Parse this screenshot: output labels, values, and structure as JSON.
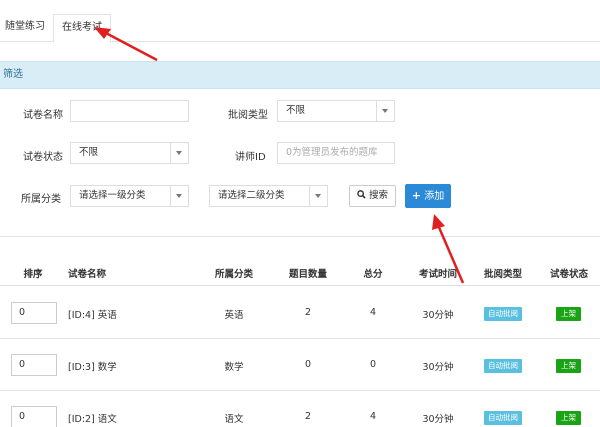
{
  "tabs": [
    {
      "label": "随堂练习",
      "active": false
    },
    {
      "label": "在线考试",
      "active": true
    }
  ],
  "filter": {
    "header": "筛选",
    "paper_name": {
      "label": "试卷名称",
      "value": ""
    },
    "review_type": {
      "label": "批阅类型",
      "value": "不限"
    },
    "paper_status": {
      "label": "试卷状态",
      "value": "不限"
    },
    "teacher_id": {
      "label": "讲师ID",
      "placeholder": "0为管理员发布的题库"
    },
    "category": {
      "label": "所属分类",
      "level1": "请选择一级分类",
      "level2": "请选择二级分类"
    },
    "search_button": "搜索",
    "add_button": "添加"
  },
  "table": {
    "headers": [
      "排序",
      "试卷名称",
      "所属分类",
      "题目数量",
      "总分",
      "考试时间",
      "批阅类型",
      "试卷状态"
    ],
    "rows": [
      {
        "sort": "0",
        "name": "[ID:4] 英语",
        "category": "英语",
        "count": "2",
        "score": "4",
        "time": "30分钟",
        "review": "自动批阅",
        "status": "上架"
      },
      {
        "sort": "0",
        "name": "[ID:3] 数学",
        "category": "数学",
        "count": "0",
        "score": "0",
        "time": "30分钟",
        "review": "自动批阅",
        "status": "上架"
      },
      {
        "sort": "0",
        "name": "[ID:2] 语文",
        "category": "语文",
        "count": "2",
        "score": "4",
        "time": "30分钟",
        "review": "自动批阅",
        "status": "上架"
      }
    ]
  },
  "colors": {
    "primary": "#2b8ad8",
    "filter_bg": "#d9edf7",
    "badge_blue": "#5bc0de",
    "badge_green": "#1aa314",
    "annotation_red": "#e02020"
  },
  "icons": {
    "search": "search-icon",
    "add": "plus-icon",
    "select": "chevron-down-icon"
  }
}
